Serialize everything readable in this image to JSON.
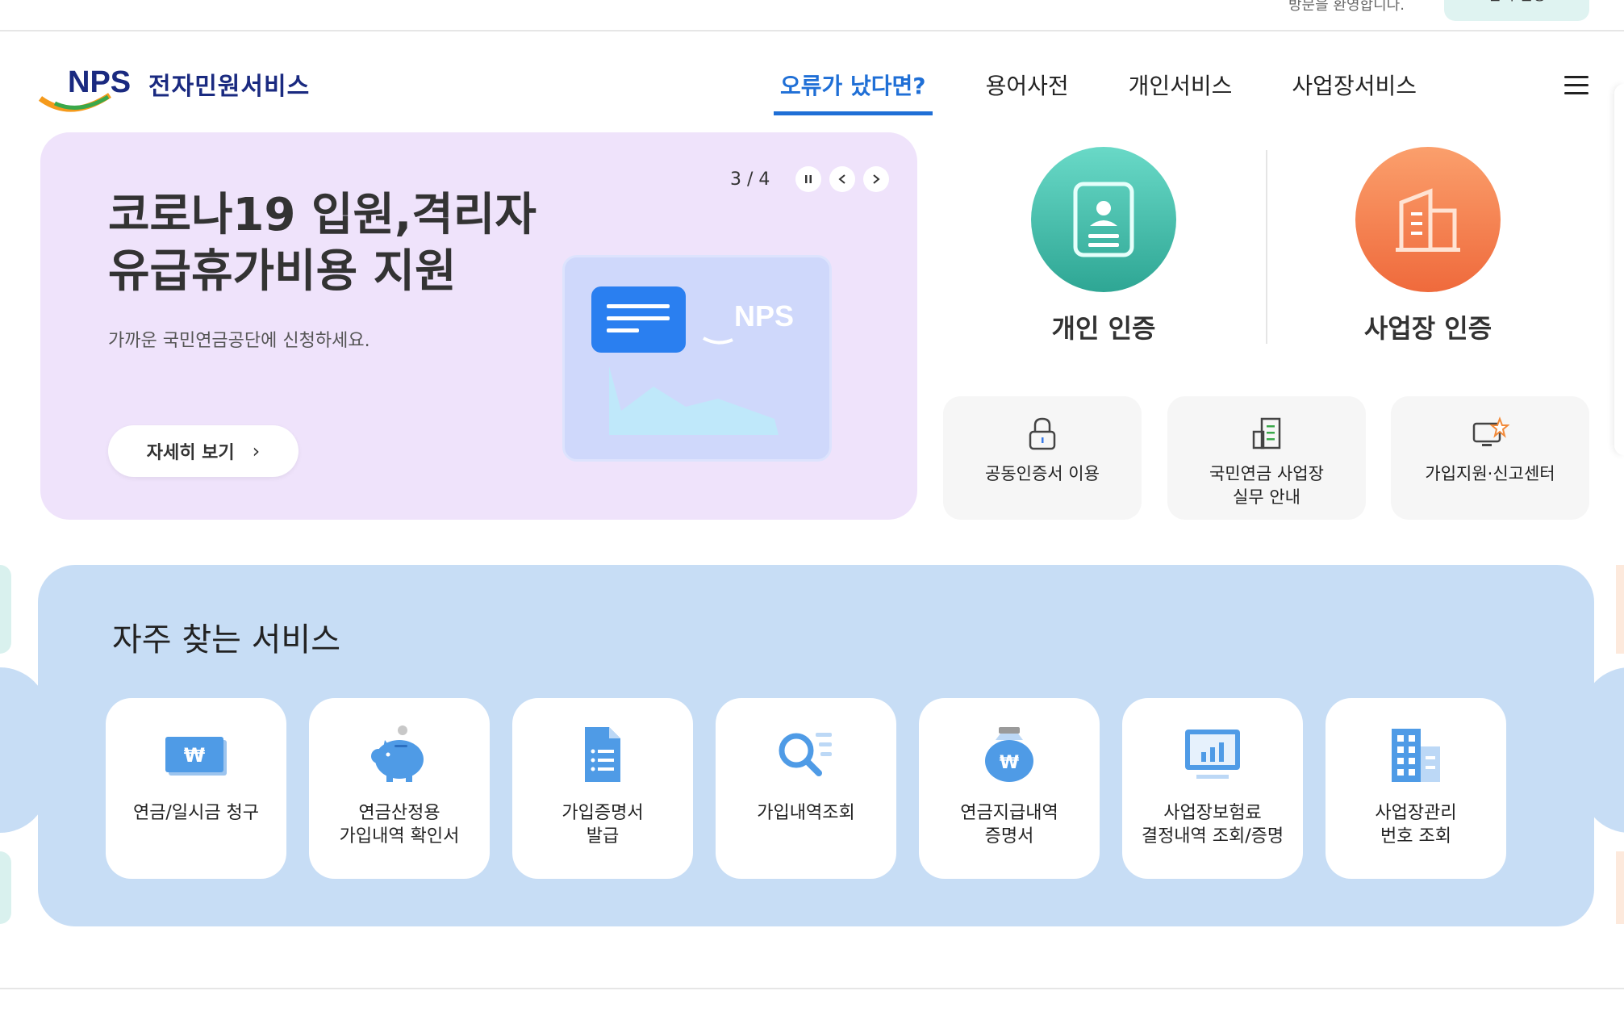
{
  "top": {
    "greeting": "방문을 환영합니다.",
    "button": "멤버 설정"
  },
  "logo": {
    "mark": "NPS",
    "text": "전자민원서비스"
  },
  "nav": [
    {
      "label": "오류가 났다면?",
      "active": true
    },
    {
      "label": "용어사전",
      "active": false
    },
    {
      "label": "개인서비스",
      "active": false
    },
    {
      "label": "사업장서비스",
      "active": false
    }
  ],
  "banner": {
    "title_line1": "코로나19 입원,격리자",
    "title_line2": "유급휴가비용 지원",
    "subtitle": "가까운 국민연금공단에 신청하세요.",
    "more_label": "자세히 보기",
    "pager": "3 / 4",
    "art_logo": "NPS",
    "bg_color": "#efe3fb"
  },
  "certs": [
    {
      "label": "개인 인증",
      "color": "#33b39f"
    },
    {
      "label": "사업장 인증",
      "color": "#f47c4e"
    }
  ],
  "quick": [
    {
      "label": "공동인증서 이용"
    },
    {
      "label": "국민연금 사업장\n실무 안내"
    },
    {
      "label": "가입지원·신고센터"
    }
  ],
  "frequent": {
    "title": "자주 찾는 서비스",
    "items": [
      {
        "label": "연금/일시금 청구"
      },
      {
        "label": "연금산정용\n가입내역 확인서"
      },
      {
        "label": "가입증명서\n발급"
      },
      {
        "label": "가입내역조회"
      },
      {
        "label": "연금지급내역\n증명서"
      },
      {
        "label": "사업장보험료\n결정내역 조회/증명"
      },
      {
        "label": "사업장관리\n번호 조회"
      }
    ]
  },
  "colors": {
    "accent": "#1f6fd6",
    "service_icon": "#4f9be6",
    "freq_bg": "#c7ddf5"
  }
}
